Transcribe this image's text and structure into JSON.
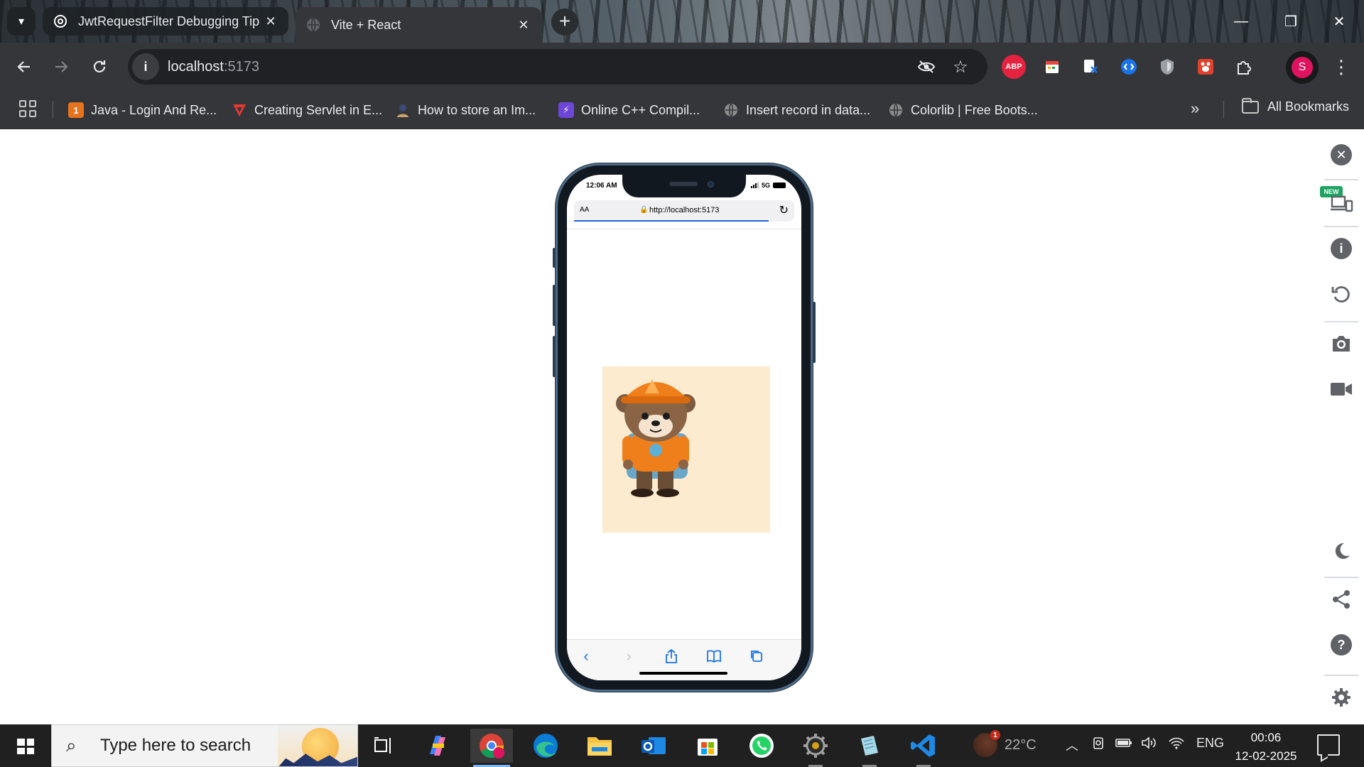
{
  "browser": {
    "tabs": [
      {
        "title": "JwtRequestFilter Debugging Tip",
        "icon": "openai-icon",
        "active": false
      },
      {
        "title": "Vite + React",
        "icon": "globe-icon",
        "active": true
      }
    ],
    "address": {
      "host": "localhost",
      "port": ":5173"
    },
    "bookmarks": [
      {
        "label": "Java - Login And Re...",
        "icon_color": "#e8731e"
      },
      {
        "label": "Creating Servlet in E...",
        "icon_color": "#e53935"
      },
      {
        "label": "How to store an Im...",
        "icon_color": "#3b4a7a"
      },
      {
        "label": "Online C++ Compil...",
        "icon_color": "#6e46d8"
      },
      {
        "label": "Insert record in data...",
        "icon_color": "#8c8c8c"
      },
      {
        "label": "Colorlib | Free Boots...",
        "icon_color": "#8c8c8c"
      }
    ],
    "all_bookmarks": "All Bookmarks",
    "extensions": [
      {
        "name": "abp-icon",
        "label": "ABP",
        "color": "#e5223f"
      },
      {
        "name": "calendar-icon",
        "label": "",
        "color": "#f1f1f1"
      },
      {
        "name": "excel-close-icon",
        "label": "",
        "color": "#2f7d4c"
      },
      {
        "name": "shazam-icon",
        "label": "",
        "color": "#1a73e8"
      },
      {
        "name": "shield-icon",
        "label": "",
        "color": "#9aa0a6"
      },
      {
        "name": "paw-icon",
        "label": "",
        "color": "#e0412c"
      },
      {
        "name": "puzzle-icon",
        "label": "",
        "color": "#e8eaed"
      }
    ],
    "profile_initial": "S"
  },
  "device": {
    "status_time": "12:06 AM",
    "network": "5G",
    "aa": "AA",
    "url": "http://localhost:5173"
  },
  "side_panel": {
    "new_badge": "NEW"
  },
  "taskbar": {
    "search_placeholder": "Type here to search",
    "weather_temp": "22°C",
    "weather_badge": "1",
    "language": "ENG",
    "time": "00:06",
    "date": "12-02-2025"
  },
  "colors": {
    "accent": "#1a73e8",
    "chrome_dark": "#35363a",
    "profile": "#e0135f"
  }
}
